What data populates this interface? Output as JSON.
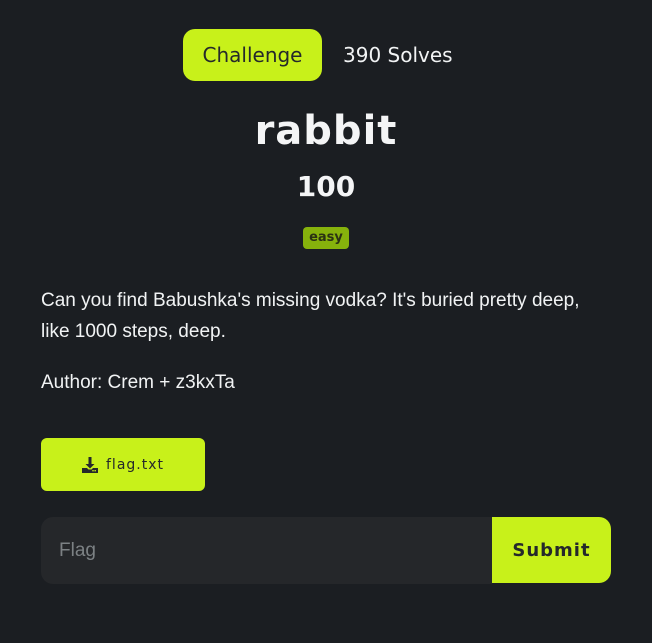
{
  "tabs": {
    "challenge_label": "Challenge",
    "solves_label": "390 Solves"
  },
  "challenge": {
    "name": "rabbit",
    "points": "100",
    "difficulty": "easy",
    "description": "Can you find Babushka's missing vodka? It's buried pretty deep, like 1000 steps, deep.",
    "author": "Author: Crem + z3kxTa"
  },
  "file": {
    "name": "flag.txt",
    "icon": "download-icon"
  },
  "flag_form": {
    "placeholder": "Flag",
    "value": "",
    "submit_label": "Submit"
  },
  "colors": {
    "background": "#1b1e22",
    "accent": "#c8f11a",
    "badge": "#86b20c",
    "input_background": "#25272a"
  }
}
